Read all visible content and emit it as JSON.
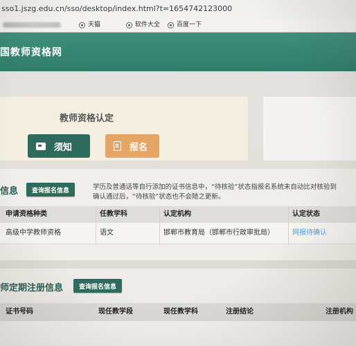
{
  "browser": {
    "url": "sso1.jszg.edu.cn/sso/desktop/index.html?t=1654742123000",
    "bookmarks": [
      {
        "label": "天猫",
        "icon": "globe-icon"
      },
      {
        "label": "软件大全",
        "icon": "globe-icon"
      },
      {
        "label": "百度一下",
        "icon": "globe-icon"
      }
    ]
  },
  "header": {
    "site_title": "国教师资格网"
  },
  "certification": {
    "title": "教师资格认定",
    "notice_button": "须知",
    "register_button": "报名",
    "notice_icon": "id-card-icon",
    "register_icon": "clipboard-icon"
  },
  "info": {
    "section_title": "信息",
    "query_button": "查询报名信息",
    "note_line1": "学历及普通话等自行添加的证书信息中，“待核验”状态指报名系统未自动比对核验到",
    "note_line2": "确认通过后，“待核验”状态也不会随之更新。",
    "table": {
      "headers": [
        "申请资格种类",
        "任教学科",
        "认定机构",
        "认定状态"
      ],
      "rows": [
        {
          "type": "高级中学教师资格",
          "subject": "语文",
          "agency": "邯郸市教育局（邯郸市行政审批局）",
          "status": "网报待确认"
        }
      ]
    }
  },
  "registration": {
    "section_title": "师定期注册信息",
    "query_button": "查询报名信息",
    "table": {
      "headers": [
        "证书号码",
        "现任教学段",
        "现任教学科",
        "注册结论",
        "注册机构"
      ]
    }
  },
  "colors": {
    "header_green": "#2f7d6a",
    "button_green": "#2f6b5c",
    "button_orange": "#e4a565",
    "link_blue": "#5b9bd5"
  }
}
